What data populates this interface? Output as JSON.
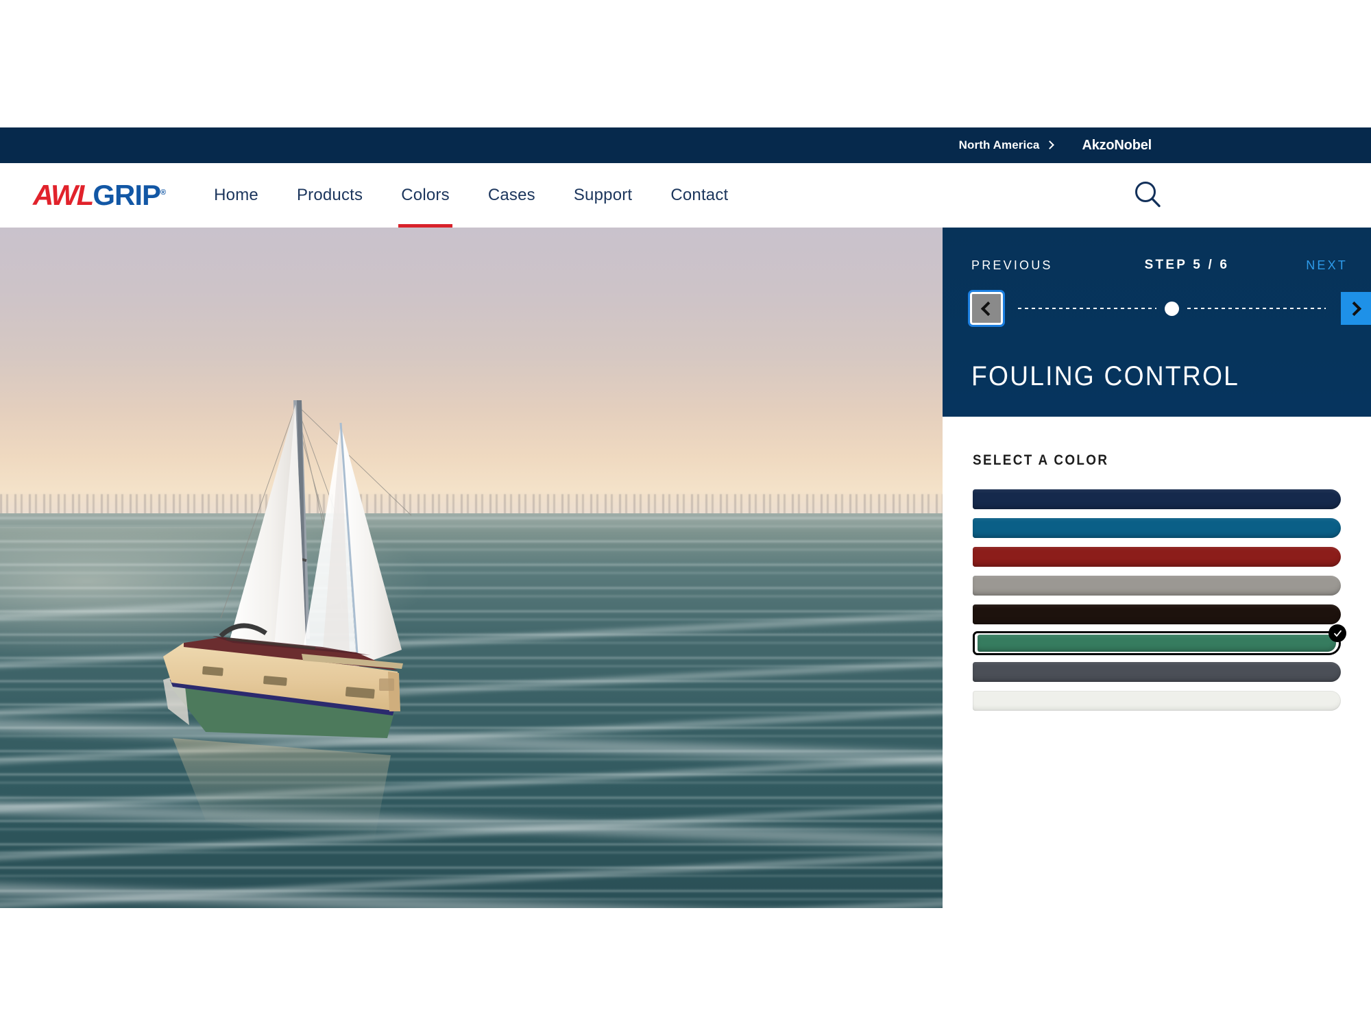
{
  "topbar": {
    "region_label": "North America",
    "region_chevron_icon": "chevron-right-icon",
    "brand": "AkzoNobel"
  },
  "header": {
    "logo_part1": "AWL",
    "logo_part2": "GRIP",
    "logo_registered": "®",
    "search_icon": "search-icon",
    "nav": [
      {
        "label": "Home",
        "active": false
      },
      {
        "label": "Products",
        "active": false
      },
      {
        "label": "Colors",
        "active": true
      },
      {
        "label": "Cases",
        "active": false
      },
      {
        "label": "Support",
        "active": false
      },
      {
        "label": "Contact",
        "active": false
      }
    ]
  },
  "visualizer": {
    "scene": "sailboat-at-sunset-on-water",
    "hull_color": "#e3c79a",
    "boot_stripe_color": "#2b2a6e",
    "antifoul_color": "#4d7a5c",
    "deck_color": "#6b2d2f",
    "sail_color": "#f4f2ef"
  },
  "panel": {
    "previous_label": "PREVIOUS",
    "step_label": "STEP 5 / 6",
    "next_label": "NEXT",
    "step_current": 5,
    "step_total": 6,
    "prev_icon": "chevron-left-icon",
    "next_icon": "chevron-right-icon",
    "title": "FOULING CONTROL",
    "select_label": "SELECT A COLOR",
    "accent_blue": "#1e91e8",
    "header_bg": "#06345e",
    "swatches": [
      {
        "name": "navy",
        "hex": "#15294c",
        "selected": false
      },
      {
        "name": "teal-blue",
        "hex": "#0a5f87",
        "selected": false
      },
      {
        "name": "dark-red",
        "hex": "#8c1d1a",
        "selected": false
      },
      {
        "name": "warm-gray",
        "hex": "#9b9893",
        "selected": false
      },
      {
        "name": "black-brown",
        "hex": "#1d120d",
        "selected": false
      },
      {
        "name": "green",
        "hex": "#367c5f",
        "selected": true
      },
      {
        "name": "slate-gray",
        "hex": "#4b4f57",
        "selected": false
      },
      {
        "name": "off-white",
        "hex": "#eff0eb",
        "selected": false
      }
    ],
    "selected_badge_icon": "check-icon"
  }
}
